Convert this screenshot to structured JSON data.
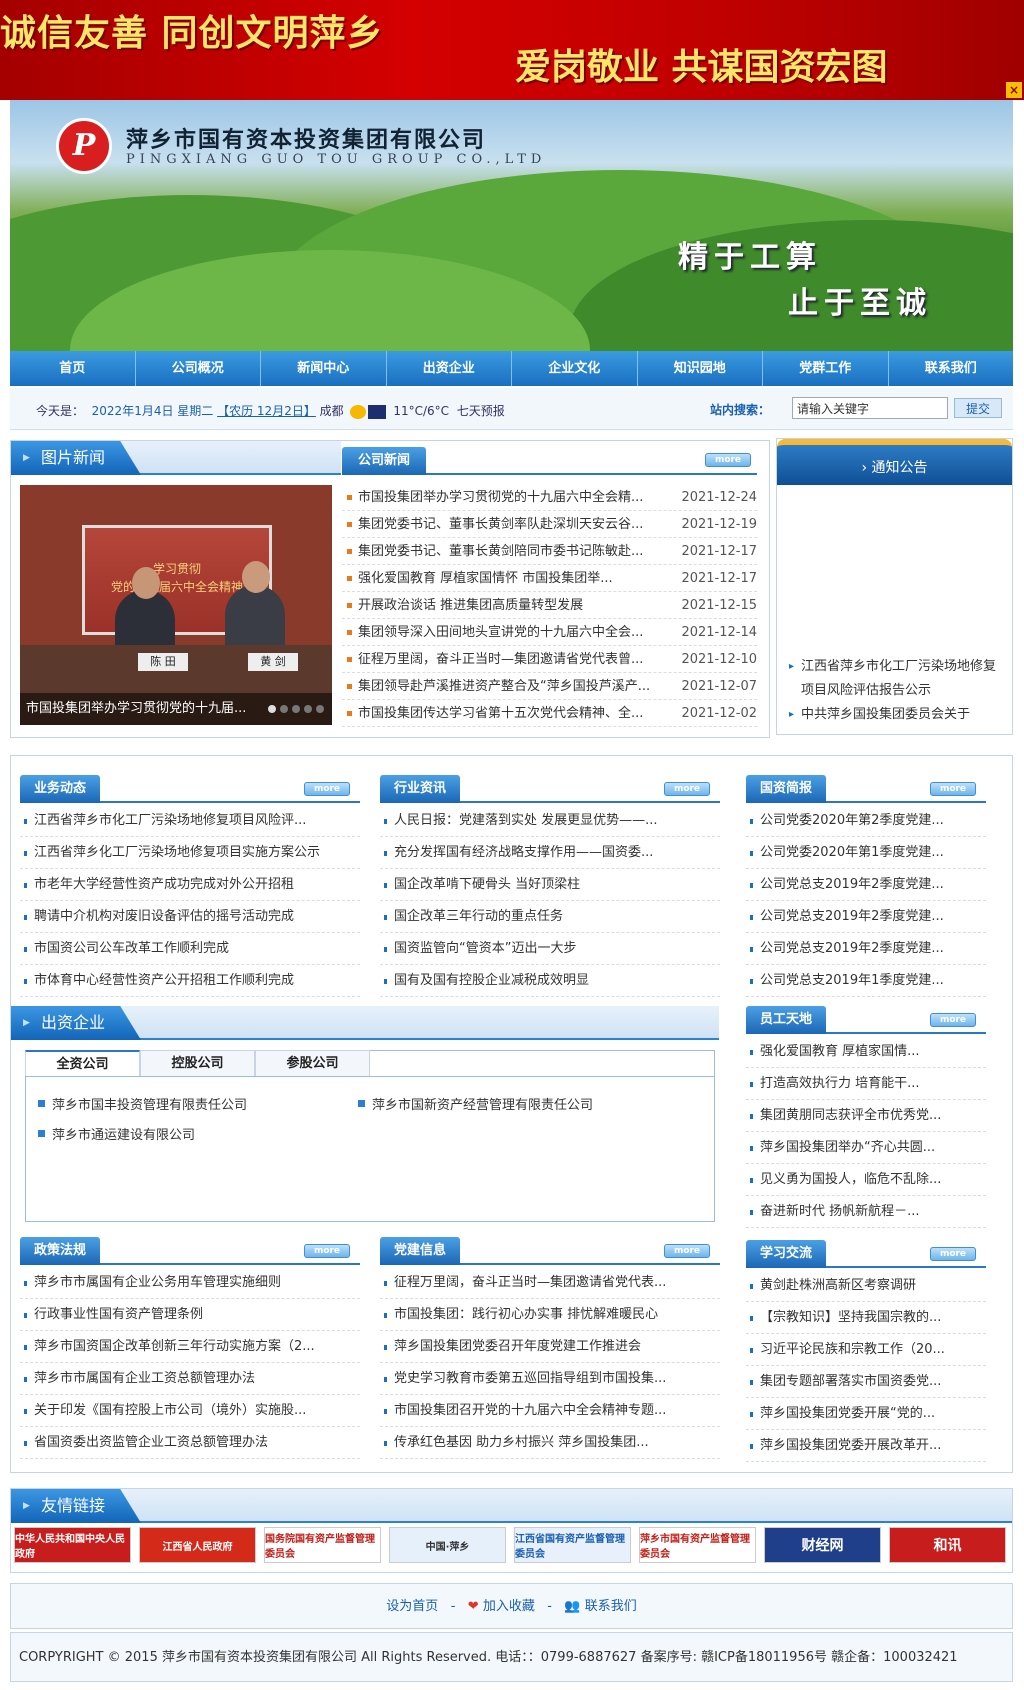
{
  "banner": {
    "line1": "诚信友善 同创文明萍乡",
    "line2": "爱岗敬业 共谋国资宏图",
    "close": "×"
  },
  "header": {
    "logo_text": "P",
    "company_cn": "萍乡市国有资本投资集团有限公司",
    "company_en": "PINGXIANG GUO TOU GROUP CO.,LTD",
    "slogan1": "精于工算",
    "slogan2": "止于至诚"
  },
  "nav": [
    "首页",
    "公司概况",
    "新闻中心",
    "出资企业",
    "企业文化",
    "知识园地",
    "党群工作",
    "联系我们"
  ],
  "info": {
    "today_label": "今天是：",
    "date": "2022年1月4日 星期二",
    "lunar": "【农历 12月2日】",
    "city": "成都",
    "temp": "11°C/6°C",
    "forecast": "七天预报",
    "search_label": "站内搜索：",
    "search_value": "请输入关键字",
    "search_btn": "提交"
  },
  "more": "more",
  "photo_news": {
    "title": "图片新闻",
    "screen_text": "学习贯彻\n党的十九届六中全会精神",
    "caption": "市国投集团举办学习贯彻党的十九届...",
    "name1": "陈 田",
    "name2": "黄 剑"
  },
  "company_news": {
    "title": "公司新闻",
    "items": [
      {
        "t": "市国投集团举办学习贯彻党的十九届六中全会精...",
        "d": "2021-12-24"
      },
      {
        "t": "集团党委书记、董事长黄剑率队赴深圳天安云谷...",
        "d": "2021-12-19"
      },
      {
        "t": "集团党委书记、董事长黄剑陪同市委书记陈敏赴...",
        "d": "2021-12-17"
      },
      {
        "t": "强化爱国教育 厚植家国情怀 市国投集团举...",
        "d": "2021-12-17"
      },
      {
        "t": "开展政治谈话 推进集团高质量转型发展",
        "d": "2021-12-15"
      },
      {
        "t": "集团领导深入田间地头宣讲党的十九届六中全会...",
        "d": "2021-12-14"
      },
      {
        "t": "征程万里阔，奋斗正当时—集团邀请省党代表曾...",
        "d": "2021-12-10"
      },
      {
        "t": "集团领导赴芦溪推进资产整合及“萍乡国投芦溪产...",
        "d": "2021-12-07"
      },
      {
        "t": "市国投集团传达学习省第十五次党代会精神、全...",
        "d": "2021-12-02"
      }
    ]
  },
  "notice": {
    "title": "通知公告",
    "items": [
      "江西省萍乡市化工厂污染场地修复项目风险评估报告公示",
      "中共萍乡国投集团委员会关于"
    ]
  },
  "biz": {
    "title": "业务动态",
    "items": [
      "江西省萍乡市化工厂污染场地修复项目风险评...",
      "江西省萍乡化工厂污染场地修复项目实施方案公示",
      "市老年大学经营性资产成功完成对外公开招租",
      "聘请中介机构对废旧设备评估的摇号活动完成",
      "市国资公司公车改革工作顺利完成",
      "市体育中心经营性资产公开招租工作顺利完成"
    ]
  },
  "industry": {
    "title": "行业资讯",
    "items": [
      "人民日报：党建落到实处 发展更显优势——...",
      "充分发挥国有经济战略支撑作用——国资委...",
      "国企改革啃下硬骨头 当好顶梁柱",
      "国企改革三年行动的重点任务",
      "国资监管向“管资本”迈出一大步",
      "国有及国有控股企业减税成效明显"
    ]
  },
  "brief": {
    "title": "国资简报",
    "items": [
      "公司党委2020年第2季度党建...",
      "公司党委2020年第1季度党建...",
      "公司党总支2019年2季度党建...",
      "公司党总支2019年2季度党建...",
      "公司党总支2019年2季度党建...",
      "公司党总支2019年1季度党建..."
    ]
  },
  "invest": {
    "title": "出资企业",
    "tabs": [
      "全资公司",
      "控股公司",
      "参股公司"
    ],
    "items": [
      "萍乡市国丰投资管理有限责任公司",
      "萍乡市国新资产经营管理有限责任公司",
      "萍乡市通运建设有限公司"
    ]
  },
  "staff": {
    "title": "员工天地",
    "items": [
      "强化爱国教育 厚植家国情...",
      "打造高效执行力 培育能干...",
      "集团黄朋同志获评全市优秀党...",
      "萍乡国投集团举办“齐心共圆...",
      "见义勇为国投人，临危不乱除...",
      "奋进新时代 扬帆新航程－..."
    ]
  },
  "policy": {
    "title": "政策法规",
    "items": [
      "萍乡市市属国有企业公务用车管理实施细则",
      "行政事业性国有资产管理条例",
      "萍乡市国资国企改革创新三年行动实施方案（2...",
      "萍乡市市属国有企业工资总额管理办法",
      "关于印发《国有控股上市公司（境外）实施股...",
      "省国资委出资监管企业工资总额管理办法"
    ]
  },
  "party": {
    "title": "党建信息",
    "items": [
      "征程万里阔，奋斗正当时—集团邀请省党代表...",
      "市国投集团：践行初心办实事 排忧解难暖民心",
      "萍乡国投集团党委召开年度党建工作推进会",
      "党史学习教育市委第五巡回指导组到市国投集...",
      "市国投集团召开党的十九届六中全会精神专题...",
      "传承红色基因 助力乡村振兴 萍乡国投集团..."
    ]
  },
  "study": {
    "title": "学习交流",
    "items": [
      "黄剑赴株洲高新区考察调研",
      "【宗教知识】坚持我国宗教的...",
      "习近平论民族和宗教工作（20...",
      "集团专题部署落实市国资委党...",
      "萍乡国投集团党委开展“党的...",
      "萍乡国投集团党委开展改革开..."
    ]
  },
  "friend_links": {
    "title": "友情链接",
    "items": [
      "中华人民共和国中央人民政府",
      "江西省人民政府",
      "国务院国有资产监督管理委员会",
      "中国·萍乡",
      "江西省国有资产监督管理委员会",
      "萍乡市国有资产监督管理委员会",
      "财经网",
      "和讯"
    ]
  },
  "footer": {
    "home": "设为首页",
    "fav": "加入收藏",
    "contact": "联系我们",
    "sep": "-",
    "copyright": "CORPYRIGHT © 2015 萍乡市国有资本投资集团有限公司 All Rights Reserved. 电话：：0799-6887627 备案序号: 赣ICP备18011956号 赣企备：100032421"
  }
}
